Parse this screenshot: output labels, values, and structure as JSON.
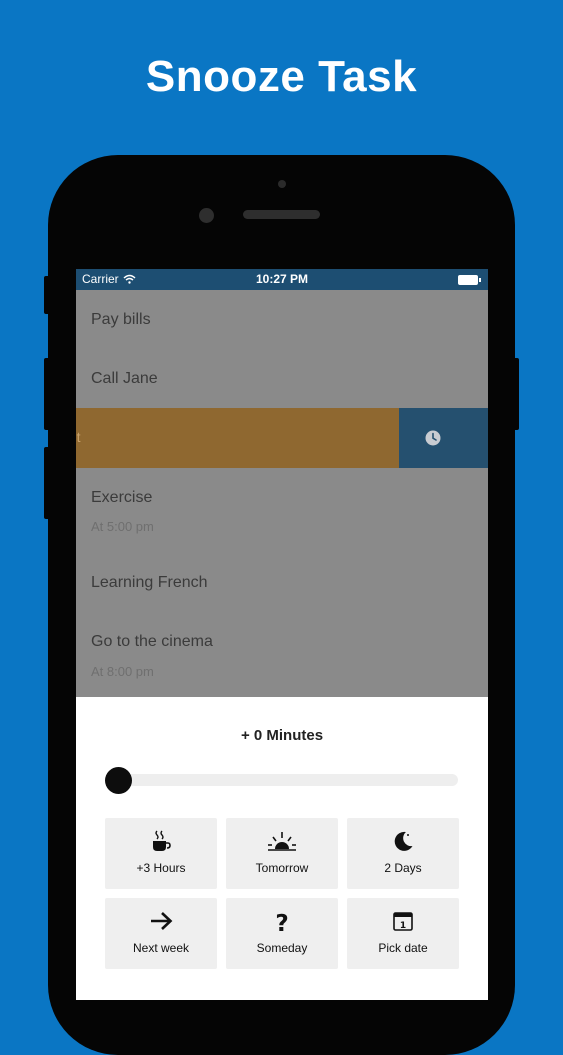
{
  "headline": "Snooze Task",
  "status_bar": {
    "carrier": "Carrier",
    "time": "10:27 PM"
  },
  "tasks": [
    {
      "title": "Pay bills"
    },
    {
      "title": "Call Jane"
    },
    {
      "title": "sent",
      "action": "snooze-clock-icon"
    },
    {
      "title": "Exercise",
      "subtitle": "At 5:00 pm"
    },
    {
      "title": "Learning French"
    },
    {
      "title": "Go to the cinema",
      "subtitle": "At 8:00 pm"
    }
  ],
  "snooze": {
    "amount_label": "+ 0 Minutes",
    "slider_value": 0,
    "options": [
      {
        "label": "+3 Hours",
        "icon": "coffee-cup-icon"
      },
      {
        "label": "Tomorrow",
        "icon": "sunrise-icon"
      },
      {
        "label": "2 Days",
        "icon": "moon-icon"
      },
      {
        "label": "Next week",
        "icon": "arrow-right-icon"
      },
      {
        "label": "Someday",
        "icon": "question-mark-icon"
      },
      {
        "label": "Pick date",
        "icon": "calendar-icon"
      }
    ]
  },
  "colors": {
    "background": "#0a76c4",
    "status_bar": "#1d4e72",
    "swipe_orange": "#8f6830",
    "swipe_blue": "#25506f",
    "overlay": "#8a8a8a"
  }
}
